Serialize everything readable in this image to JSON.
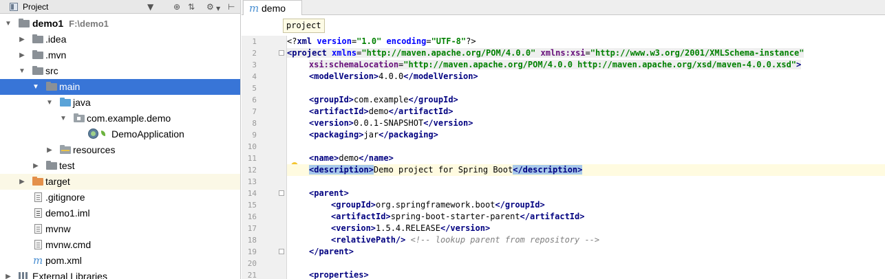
{
  "panel": {
    "title": "Project",
    "dropdown_icon": "chevron-down-icon",
    "toolbar_icons": [
      "target-icon",
      "collapse-icon",
      "gear-icon",
      "pin-icon"
    ]
  },
  "tree": [
    {
      "label": "demo1",
      "hint": "F:\\demo1",
      "icon": "module-folder-icon",
      "expanded": true
    },
    {
      "label": ".idea",
      "icon": "folder-icon",
      "expanded": false
    },
    {
      "label": ".mvn",
      "icon": "folder-icon",
      "expanded": false
    },
    {
      "label": "src",
      "icon": "folder-icon",
      "expanded": true
    },
    {
      "label": "main",
      "icon": "folder-icon",
      "expanded": true,
      "selected": true
    },
    {
      "label": "java",
      "icon": "source-folder-icon",
      "expanded": true
    },
    {
      "label": "com.example.demo",
      "icon": "package-icon",
      "expanded": true
    },
    {
      "label": "DemoApplication",
      "icon": "spring-boot-class-icon"
    },
    {
      "label": "resources",
      "icon": "resources-folder-icon",
      "expanded": false
    },
    {
      "label": "test",
      "icon": "folder-icon",
      "expanded": false
    },
    {
      "label": "target",
      "icon": "excluded-folder-icon",
      "expanded": false
    },
    {
      "label": ".gitignore",
      "icon": "text-file-icon"
    },
    {
      "label": "demo1.iml",
      "icon": "iml-file-icon"
    },
    {
      "label": "mvnw",
      "icon": "text-file-icon"
    },
    {
      "label": "mvnw.cmd",
      "icon": "text-file-icon"
    },
    {
      "label": "pom.xml",
      "icon": "maven-file-icon"
    },
    {
      "label": "External Libraries",
      "icon": "libraries-icon",
      "expanded": false
    }
  ],
  "editor": {
    "tab_label": "demo",
    "tab_icon": "maven-m-icon",
    "breadcrumb": "project",
    "current_line": 12,
    "lines": [
      "1",
      "2",
      "3",
      "4",
      "5",
      "6",
      "7",
      "8",
      "9",
      "10",
      "11",
      "12",
      "13",
      "14",
      "15",
      "16",
      "17",
      "18",
      "19",
      "20",
      "21"
    ]
  },
  "code": {
    "l1": {
      "open": "<?",
      "name": "xml",
      "a1": " version",
      "eq1": "=",
      "v1": "\"1.0\"",
      "a2": " encoding",
      "eq2": "=",
      "v2": "\"UTF-8\"",
      "close": "?>"
    },
    "l2": {
      "open": "<",
      "tag": "project",
      "a1": " xmlns",
      "eq1": "=",
      "v1": "\"http://maven.apache.org/POM/4.0.0\"",
      "ns": " xmlns:xsi",
      "eq2": "=",
      "v2": "\"http://www.w3.org/2001/XMLSchema-instance\""
    },
    "l3": {
      "ns": "xsi:schemaLocation",
      "eq": "=",
      "v": "\"http://maven.apache.org/POM/4.0.0 http://maven.apache.org/xsd/maven-4.0.0.xsd\"",
      "close": ">"
    },
    "l4": {
      "otag": "<modelVersion>",
      "text": "4.0.0",
      "ctag": "</modelVersion>"
    },
    "l6": {
      "otag": "<groupId>",
      "text": "com.example",
      "ctag": "</groupId>"
    },
    "l7": {
      "otag": "<artifactId>",
      "text": "demo",
      "ctag": "</artifactId>"
    },
    "l8": {
      "otag": "<version>",
      "text": "0.0.1-SNAPSHOT",
      "ctag": "</version>"
    },
    "l9": {
      "otag": "<packaging>",
      "text": "jar",
      "ctag": "</packaging>"
    },
    "l11": {
      "otag": "<name>",
      "text": "demo",
      "ctag": "</name>"
    },
    "l12": {
      "otag": "<description>",
      "text": "Demo project for Spring Boot",
      "ctag": "</description>"
    },
    "l14": {
      "otag": "<parent>"
    },
    "l15": {
      "otag": "<groupId>",
      "text": "org.springframework.boot",
      "ctag": "</groupId>"
    },
    "l16": {
      "otag": "<artifactId>",
      "text": "spring-boot-starter-parent",
      "ctag": "</artifactId>"
    },
    "l17": {
      "otag": "<version>",
      "text": "1.5.4.RELEASE",
      "ctag": "</version>"
    },
    "l18": {
      "otag": "<relativePath/>",
      "comment": " <!-- lookup parent from repository -->"
    },
    "l19": {
      "ctag": "</parent>"
    },
    "l21": {
      "otag": "<properties>"
    }
  },
  "colors": {
    "selection": "#3875d7",
    "current_line": "#fffbe0",
    "tag": "#000080",
    "attr": "#0000ff",
    "string": "#008000",
    "comment": "#808080"
  }
}
